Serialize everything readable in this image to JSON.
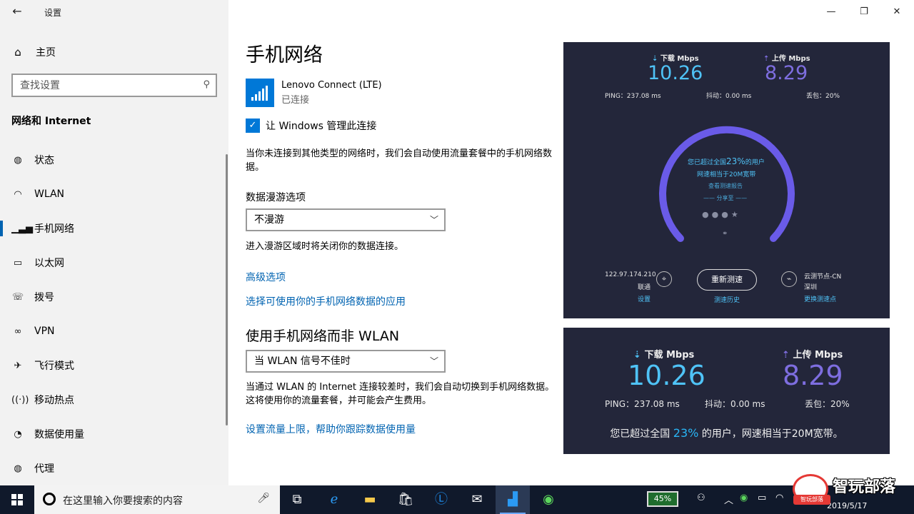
{
  "window": {
    "title": "设置",
    "back": "←",
    "minimize": "—",
    "restore": "❐",
    "close": "✕"
  },
  "sidebar": {
    "home": "主页",
    "search_placeholder": "查找设置",
    "section_title": "网络和 Internet",
    "items": [
      {
        "label": "状态",
        "icon": "globe-icon"
      },
      {
        "label": "WLAN",
        "icon": "wifi-icon"
      },
      {
        "label": "手机网络",
        "icon": "cellular-icon",
        "active": true
      },
      {
        "label": "以太网",
        "icon": "ethernet-icon"
      },
      {
        "label": "拨号",
        "icon": "dialup-icon"
      },
      {
        "label": "VPN",
        "icon": "vpn-icon"
      },
      {
        "label": "飞行模式",
        "icon": "airplane-icon"
      },
      {
        "label": "移动热点",
        "icon": "hotspot-icon"
      },
      {
        "label": "数据使用量",
        "icon": "data-usage-icon"
      },
      {
        "label": "代理",
        "icon": "proxy-globe-icon"
      }
    ]
  },
  "main": {
    "title": "手机网络",
    "connection": {
      "name": "Lenovo Connect (LTE)",
      "status": "已连接"
    },
    "manage_checkbox": {
      "label": "让 Windows 管理此连接",
      "checked": true
    },
    "manage_desc": "当你未连接到其他类型的网络时，我们会自动使用流量套餐中的手机网络数据。",
    "roaming_label": "数据漫游选项",
    "roaming_value": "不漫游",
    "roaming_desc": "进入漫游区域时将关闭你的数据连接。",
    "advanced_link": "高级选项",
    "apps_link": "选择可使用你的手机网络数据的应用",
    "prefer_title": "使用手机网络而非 WLAN",
    "prefer_value": "当 WLAN 信号不佳时",
    "prefer_desc": "当通过 WLAN 的 Internet 连接较差时，我们会自动切换到手机网络数据。这将使用你的流量套餐，并可能会产生费用。",
    "limit_link": "设置流量上限，帮助你跟踪数据使用量"
  },
  "speedtest": {
    "download_label": "下载 Mbps",
    "upload_label": "上传 Mbps",
    "download_value": "10.26",
    "upload_value": "8.29",
    "ping": "PING：237.08 ms",
    "jitter": "抖动：0.00 ms",
    "loss": "丢包：20%",
    "gauge_line1_pre": "您已超过全国",
    "gauge_pct": "23%",
    "gauge_line1_post": "的用户",
    "gauge_line2": "网速相当于20M宽带",
    "gauge_report": "查看测速报告",
    "gauge_share": "—— 分享至 ——",
    "ip": "122.97.174.210",
    "isp": "联通",
    "settings_link": "设置",
    "retest": "重新测速",
    "history_link": "测速历史",
    "node": "云测节点-CN",
    "city": "深圳",
    "change_node": "更换测速点",
    "download_color": "#4fc3f7",
    "upload_color": "#7e6ee0",
    "gauge_color": "#6a5be8",
    "summary_pre": "您已超过全国 ",
    "summary_pct": "23%",
    "summary_post": " 的用户，网速相当于20M宽带。"
  },
  "taskbar": {
    "search_text": "在这里输入你要搜索的内容",
    "battery": "45%",
    "clock": "2019/5/17"
  },
  "watermark": {
    "text": "智玩部落",
    "tag": "智玩部落"
  }
}
